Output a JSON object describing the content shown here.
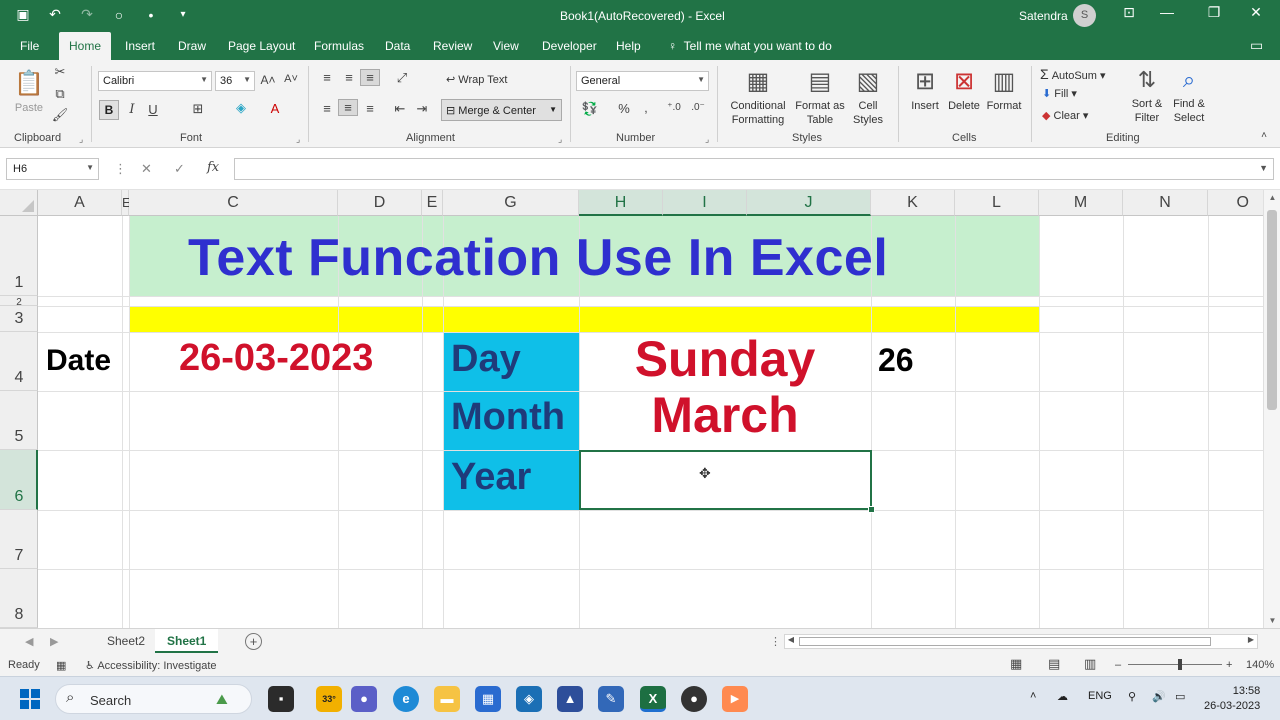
{
  "titlebar": {
    "title": "Book1(AutoRecovered)  -  Excel",
    "user": "Satendra",
    "avatar_initial": "S"
  },
  "tabs": [
    "File",
    "Home",
    "Insert",
    "Draw",
    "Page Layout",
    "Formulas",
    "Data",
    "Review",
    "View",
    "Developer",
    "Help"
  ],
  "tellme": "Tell me what you want to do",
  "ribbon": {
    "clipboard": {
      "label": "Clipboard",
      "paste": "Paste"
    },
    "font": {
      "label": "Font",
      "name": "Calibri",
      "size": "36",
      "bold": "B",
      "italic": "I",
      "underline": "U"
    },
    "alignment": {
      "label": "Alignment",
      "wrap": "Wrap Text",
      "merge": "Merge & Center"
    },
    "number": {
      "label": "Number",
      "format": "General",
      "percent": "%",
      "comma": "‚"
    },
    "styles": {
      "label": "Styles",
      "cond1": "Conditional",
      "cond2": "Formatting",
      "fmt1": "Format as",
      "fmt2": "Table",
      "cell1": "Cell",
      "cell2": "Styles"
    },
    "cells": {
      "label": "Cells",
      "insert": "Insert",
      "delete": "Delete",
      "format": "Format"
    },
    "editing": {
      "label": "Editing",
      "autosum": "AutoSum",
      "fill": "Fill",
      "clear": "Clear",
      "sort1": "Sort &",
      "sort2": "Filter",
      "find1": "Find &",
      "find2": "Select"
    }
  },
  "formula_bar": {
    "name_box": "H6",
    "formula": ""
  },
  "columns": [
    "A",
    "E",
    "C",
    "D",
    "E",
    "G",
    "H",
    "I",
    "J",
    "K",
    "L",
    "M",
    "N",
    "O"
  ],
  "rows": [
    "1",
    "2",
    "3",
    "4",
    "5",
    "6",
    "7",
    "8"
  ],
  "cells": {
    "title": "Text Funcation Use In Excel",
    "a4": "Date",
    "c4": "26-03-2023",
    "g4": "Day",
    "g5": "Month",
    "g6": "Year",
    "h4": "Sunday",
    "h5": "March",
    "k4": "26"
  },
  "sheets": [
    "Sheet2",
    "Sheet1"
  ],
  "active_sheet": "Sheet1",
  "status": {
    "ready": "Ready",
    "accessibility": "Accessibility: Investigate",
    "zoom": "140%"
  },
  "taskbar": {
    "search": "Search",
    "weather": "33°",
    "lang": "ENG",
    "time": "13:58",
    "date": "26-03-2023"
  },
  "colors": {
    "excel_green": "#217346",
    "title_fill": "#c6efce",
    "band": "#ffff00",
    "label_fill": "#0fbfe8",
    "title_text": "#2f2fcf",
    "date_text": "#d0112b",
    "label_text": "#1f3b7a"
  }
}
